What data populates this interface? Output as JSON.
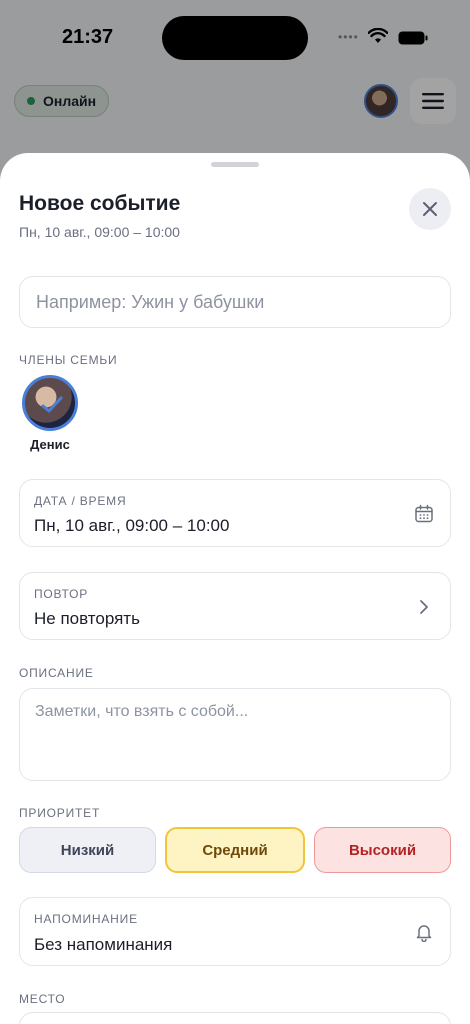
{
  "status_bar": {
    "time": "21:37"
  },
  "header": {
    "online_label": "Онлайн"
  },
  "sheet": {
    "title": "Новое событие",
    "subtitle": "Пн, 10 авг., 09:00 – 10:00",
    "title_placeholder": "Например: Ужин у бабушки",
    "members_label": "ЧЛЕНЫ СЕМЬИ",
    "members": [
      {
        "name": "Денис",
        "selected": true
      }
    ],
    "datetime": {
      "label": "ДАТА / ВРЕМЯ",
      "value": "Пн, 10 авг., 09:00 – 10:00"
    },
    "repeat": {
      "label": "ПОВТОР",
      "value": "Не повторять"
    },
    "description": {
      "label": "ОПИСАНИЕ",
      "placeholder": "Заметки, что взять с собой..."
    },
    "priority": {
      "label": "ПРИОРИТЕТ",
      "options": [
        "Низкий",
        "Средний",
        "Высокий"
      ],
      "selected": "Средний"
    },
    "reminder": {
      "label": "НАПОМИНАНИЕ",
      "value": "Без напоминания"
    },
    "place": {
      "label": "МЕСТО"
    }
  },
  "colors": {
    "accent": "#4a7fd8",
    "online": "#2e9a5c",
    "priority_mid": "#f0c53a",
    "priority_high": "#ef9a9a"
  }
}
